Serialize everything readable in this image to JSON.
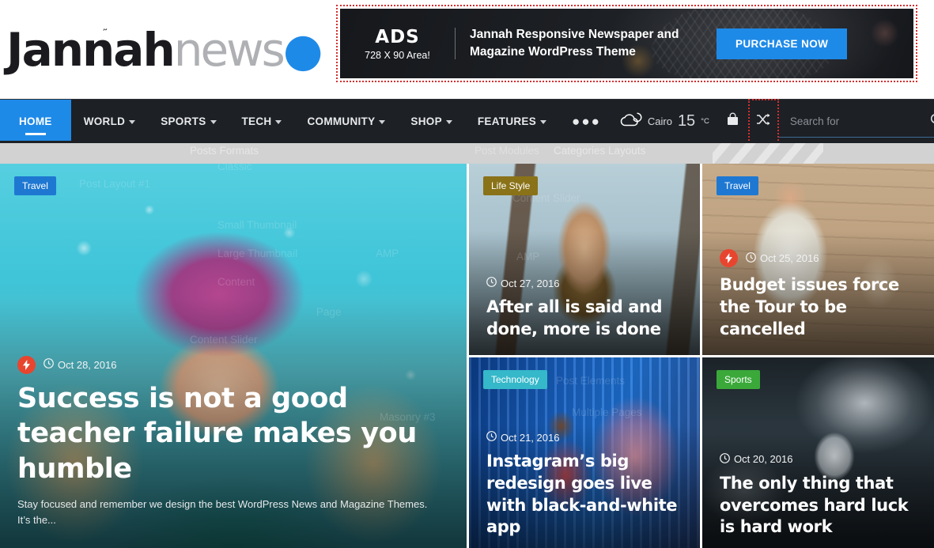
{
  "brand": {
    "name_bold": "Jannah",
    "name_light": "news",
    "dot": "●",
    "tick": "˜"
  },
  "ad": {
    "label_big": "ADS",
    "label_small": "728 X 90 Area!",
    "headline": "Jannah Responsive Newspaper and Magazine WordPress Theme",
    "button": "PURCHASE NOW",
    "button_color": "#1e8ae8"
  },
  "nav": {
    "items": [
      {
        "label": "HOME",
        "has_caret": false,
        "active": true
      },
      {
        "label": "WORLD",
        "has_caret": true,
        "active": false
      },
      {
        "label": "SPORTS",
        "has_caret": true,
        "active": false
      },
      {
        "label": "TECH",
        "has_caret": true,
        "active": false
      },
      {
        "label": "COMMUNITY",
        "has_caret": true,
        "active": false
      },
      {
        "label": "SHOP",
        "has_caret": true,
        "active": false
      },
      {
        "label": "FEATURES",
        "has_caret": true,
        "active": false
      }
    ],
    "more_dots": "●●●",
    "active_color": "#1e8ae8",
    "bar_color": "#1d2025"
  },
  "weather": {
    "icon": "cloud-moon-icon",
    "city": "Cairo",
    "temperature": "15",
    "unit": "°C"
  },
  "toolbar": {
    "cart_icon": "shopping-bag-icon",
    "random_icon": "random-shuffle-icon",
    "search_icon": "search-icon"
  },
  "search": {
    "placeholder": "Search for",
    "value": ""
  },
  "ghost_menu": {
    "items": [
      "Posts Formats",
      "Categories Layouts",
      "Post Layout #1",
      "Classic",
      "Small Thumbnail",
      "Large Thumbnail",
      "Content",
      "Post Modules",
      "Content Slider",
      "AMP",
      "Masonry #3",
      "Multiple Pages",
      "Page",
      "Post Elements"
    ]
  },
  "hero": {
    "category": "Travel",
    "category_color": "#1e78d2",
    "has_bolt": true,
    "bolt_icon": "lightning-bolt-icon",
    "date": "Oct 28, 2016",
    "title": "Success is not a good teacher failure makes you humble",
    "excerpt": "Stay focused and remember we design the best WordPress News and Magazine Themes. It’s the..."
  },
  "cards": [
    {
      "category": "Life Style",
      "category_color": "#8a7218",
      "has_bolt": false,
      "date": "Oct 27, 2016",
      "title": "After all is said and done, more is done"
    },
    {
      "category": "Travel",
      "category_color": "#1e78d2",
      "has_bolt": true,
      "date": "Oct 25, 2016",
      "title": "Budget issues force the Tour to be cancelled"
    },
    {
      "category": "Technology",
      "category_color": "#35b8c9",
      "has_bolt": false,
      "date": "Oct 21, 2016",
      "title": "Instagram’s big redesign goes live with black-and-white app"
    },
    {
      "category": "Sports",
      "category_color": "#3aa93a",
      "has_bolt": false,
      "date": "Oct 20, 2016",
      "title": "The only thing that overcomes hard luck is hard work"
    }
  ],
  "icons": {
    "clock": "◴",
    "bolt": "⚡",
    "magnifier": "⌕"
  }
}
